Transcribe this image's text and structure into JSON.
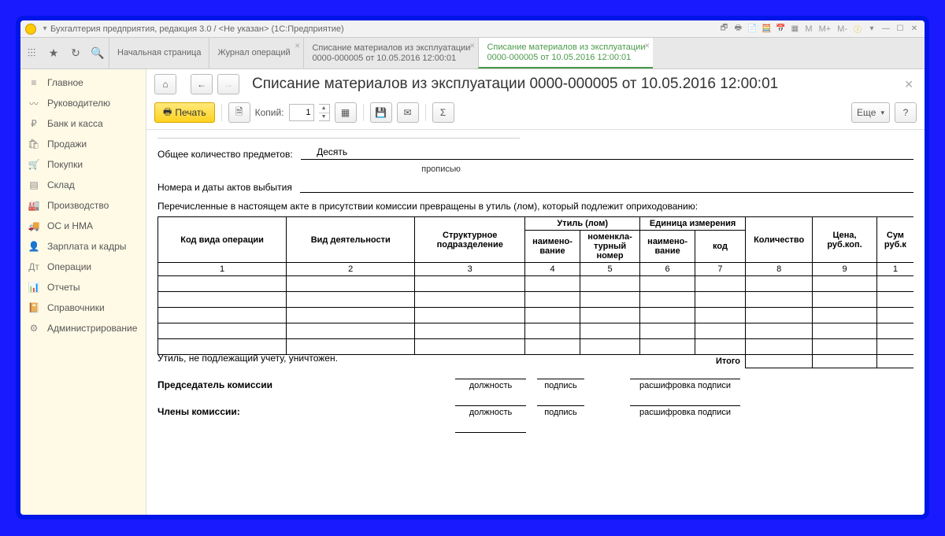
{
  "window_title": "Бухгалтерия предприятия, редакция 3.0 / <Не указан> (1С:Предприятие)",
  "title_m": [
    "M",
    "M+",
    "M-"
  ],
  "tabs": [
    {
      "line1": "Начальная страница",
      "line2": "",
      "closable": false
    },
    {
      "line1": "Журнал операций",
      "line2": "",
      "closable": true
    },
    {
      "line1": "Списание материалов из эксплуатации",
      "line2": "0000-000005 от 10.05.2016 12:00:01",
      "closable": true
    },
    {
      "line1": "Списание материалов из эксплуатации",
      "line2": "0000-000005 от 10.05.2016 12:00:01",
      "closable": true,
      "active": true
    }
  ],
  "sidebar": [
    {
      "label": "Главное",
      "icon": "≡"
    },
    {
      "label": "Руководителю",
      "icon": "〰"
    },
    {
      "label": "Банк и касса",
      "icon": "₽"
    },
    {
      "label": "Продажи",
      "icon": "🛍"
    },
    {
      "label": "Покупки",
      "icon": "🛒"
    },
    {
      "label": "Склад",
      "icon": "▤"
    },
    {
      "label": "Производство",
      "icon": "🏭"
    },
    {
      "label": "ОС и НМА",
      "icon": "🚚"
    },
    {
      "label": "Зарплата и кадры",
      "icon": "👤"
    },
    {
      "label": "Операции",
      "icon": "Дт"
    },
    {
      "label": "Отчеты",
      "icon": "📊"
    },
    {
      "label": "Справочники",
      "icon": "📔"
    },
    {
      "label": "Администрирование",
      "icon": "⚙"
    }
  ],
  "page_title": "Списание материалов из эксплуатации 0000-000005 от 10.05.2016 12:00:01",
  "toolbar": {
    "print": "Печать",
    "copies_lbl": "Копий:",
    "copies_val": "1",
    "more": "Еще",
    "help": "?"
  },
  "doc": {
    "total_items_lbl": "Общее количество предметов:",
    "total_items_val": "Десять",
    "total_items_sub": "прописью",
    "acts_lbl": "Номера и даты актов выбытия",
    "statement": "Перечисленные в настоящем акте в присутствии комиссии превращены в утиль (лом), который подлежит оприходованию:",
    "headers": {
      "col1": "Код вида операции",
      "col2": "Вид деятельности",
      "col3": "Структурное подразделение",
      "scrap": "Утиль (лом)",
      "scrap_a": "наимено-\nвание",
      "scrap_b": "номенкла-\nтурный номер",
      "unit": "Единица измерения",
      "unit_a": "наимено-\nвание",
      "unit_b": "код",
      "qty": "Количество",
      "price": "Цена, руб.коп.",
      "sum": "Сум руб.к"
    },
    "colnums": [
      "1",
      "2",
      "3",
      "4",
      "5",
      "6",
      "7",
      "8",
      "9",
      "1"
    ],
    "itogo": "Итого",
    "destroyed": "Утиль, не подлежащий учету, уничтожен.",
    "chairman": "Председатель комиссии",
    "members": "Члены комиссии:",
    "sig_position": "должность",
    "sig_sign": "подпись",
    "sig_decode": "расшифровка подписи"
  }
}
